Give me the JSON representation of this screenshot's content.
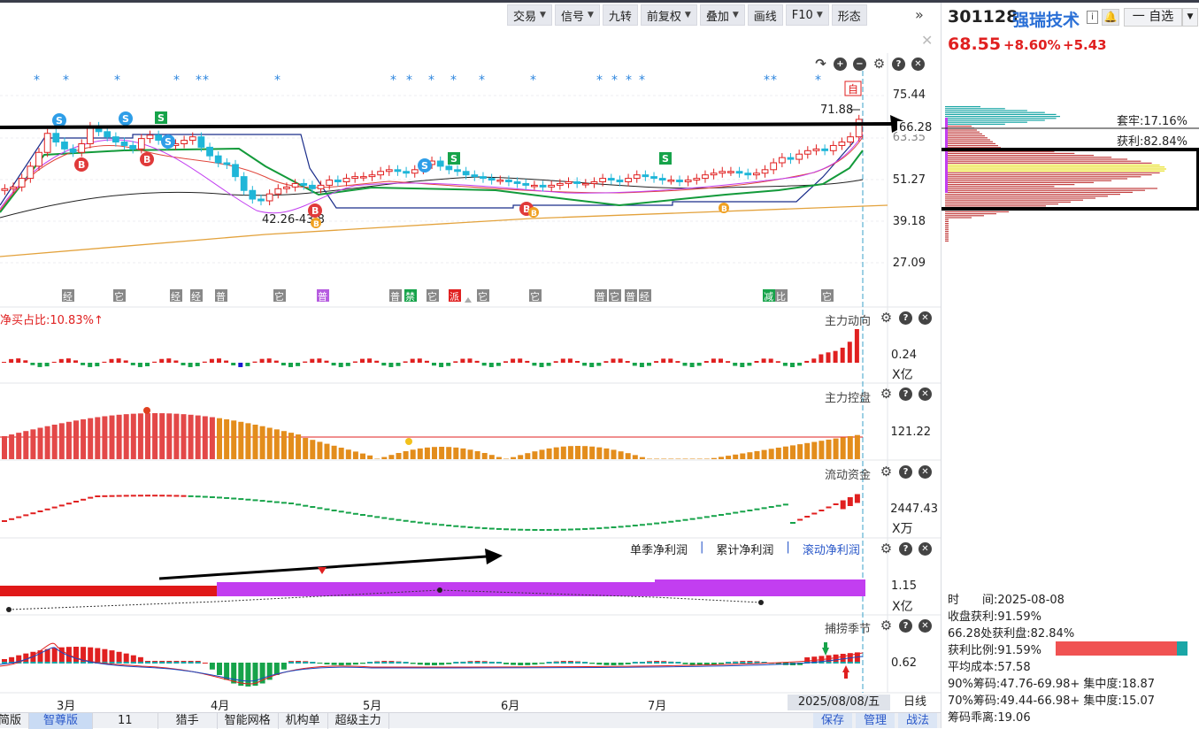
{
  "toolbar": [
    {
      "label": "交易",
      "dropdown": true
    },
    {
      "label": "信号",
      "dropdown": true
    },
    {
      "label": "九转",
      "dropdown": false
    },
    {
      "label": "前复权",
      "dropdown": true
    },
    {
      "label": "叠加",
      "dropdown": true
    },
    {
      "label": "画线",
      "dropdown": false
    },
    {
      "label": "F10",
      "dropdown": true
    },
    {
      "label": "形态",
      "dropdown": false
    }
  ],
  "toolbar_more": "»",
  "main_chart": {
    "price_axis": [
      "75.44",
      "63.35",
      "51.27",
      "39.18",
      "27.09"
    ],
    "labels": {
      "current_line": "66.28",
      "high_label": "71.88",
      "low_label": "42.26-43.8",
      "self_tag": "自"
    },
    "signal_tags": [
      "经",
      "它",
      "经",
      "经",
      "普",
      "它",
      "普",
      "普",
      "禁",
      "它",
      "派",
      "它",
      "它",
      "普",
      "它",
      "普",
      "经",
      "减",
      "比",
      "它",
      "它"
    ],
    "candles": [
      48.5,
      49.0,
      51.5,
      55.0,
      59.0,
      64.5,
      62.0,
      60.0,
      59.0,
      61.5,
      66.5,
      65.0,
      63.5,
      62.0,
      61.0,
      60.0,
      63.0,
      64.0,
      62.5,
      61.0,
      61.5,
      62.5,
      63.5,
      60.5,
      58.0,
      56.0,
      55.5,
      52.0,
      48.0,
      45.5,
      45.0,
      47.0,
      48.5,
      49.0,
      50.0,
      49.5,
      48.5,
      49.5,
      51.0,
      50.5,
      51.5,
      52.0,
      52.0,
      52.5,
      53.5,
      54.0,
      53.5,
      53.0,
      54.0,
      55.5,
      56.5,
      55.0,
      54.0,
      53.5,
      52.5,
      52.0,
      51.5,
      51.0,
      51.0,
      50.5,
      50.0,
      49.5,
      49.5,
      49.0,
      49.5,
      50.0,
      50.5,
      50.0,
      50.0,
      50.5,
      51.5,
      51.0,
      50.5,
      51.5,
      52.5,
      52.0,
      51.5,
      51.0,
      51.0,
      50.5,
      51.0,
      51.5,
      52.5,
      53.0,
      53.5,
      53.5,
      53.0,
      52.5,
      53.0,
      54.0,
      56.0,
      57.5,
      57.0,
      58.5,
      59.5,
      60.0,
      59.5,
      61.0,
      62.0,
      63.5,
      68.55
    ]
  },
  "panels": {
    "main_force_dir": {
      "title": "主力动向",
      "prefix": "净买占比:10.83%↑",
      "axis": "0.24",
      "unit": "X亿"
    },
    "main_force_ctrl": {
      "title": "主力控盘",
      "axis": "121.22"
    },
    "liquid_funds": {
      "title": "流动资金",
      "axis": "2447.43",
      "unit": "X万"
    },
    "profit": {
      "tabs": [
        "单季净利润",
        "累计净利润",
        "滚动净利润"
      ],
      "active_tab": "滚动净利润",
      "axis": "1.15",
      "unit": "X亿"
    },
    "season": {
      "title": "捕捞季节",
      "axis": "0.62"
    }
  },
  "months": [
    "3月",
    "4月",
    "5月",
    "6月",
    "7月"
  ],
  "current_date": "2025/08/08/五",
  "period": "日线",
  "bottom_tabs": [
    "简版",
    "智尊版",
    "11",
    "猎手",
    "智能网格",
    "机构单",
    "超级主力"
  ],
  "active_bottom_tab": "智尊版",
  "bottom_actions": [
    "保存",
    "管理",
    "战法"
  ],
  "stock": {
    "code": "301128",
    "name": "强瑞技术",
    "watch_label": "一 自选",
    "price": "68.55",
    "change_pct": "+8.60%",
    "change": "+5.43"
  },
  "chips": {
    "trapped": "套牢:17.16%",
    "profit": "获利:82.84%",
    "stats": [
      "时　　间:2025-08-08",
      "收盘获利:91.59%",
      "66.28处获利盘:82.84%",
      "获利比例:91.59%",
      "平均成本:57.58",
      "90%筹码:47.76-69.98+ 集中度:18.87",
      "70%筹码:49.44-66.98+ 集中度:15.07",
      "筹码乖离:19.06"
    ]
  },
  "colors": {
    "up": "#e02020",
    "down": "#12a53a",
    "accent": "#2a58c9",
    "purple": "#c23ef0",
    "orange": "#e38d1c"
  }
}
